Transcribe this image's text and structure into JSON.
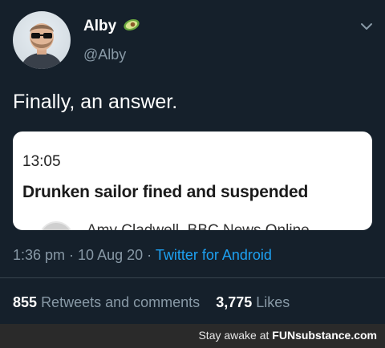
{
  "tweet": {
    "display_name": "Alby",
    "handle": "@Alby",
    "text": "Finally, an answer.",
    "card": {
      "time": "13:05",
      "headline": "Drunken sailor fined and suspended",
      "byline": "Amy Cladwell, BBC News Online"
    },
    "meta": {
      "time": "1:36 pm",
      "sep1": " · ",
      "date": "10 Aug 20",
      "sep2": " · ",
      "source": "Twitter for Android"
    },
    "stats": {
      "retweets": "855",
      "retweets_label": "Retweets and comments",
      "likes": "3,775",
      "likes_label": "Likes"
    }
  },
  "footer": {
    "prefix": "Stay awake at",
    "brand": "FUNsubstance.com"
  },
  "colors": {
    "background": "#15202b",
    "link": "#1da1f2",
    "muted": "#8899a6"
  },
  "icons": [
    "avocado-emoji-icon",
    "chevron-down-icon"
  ]
}
